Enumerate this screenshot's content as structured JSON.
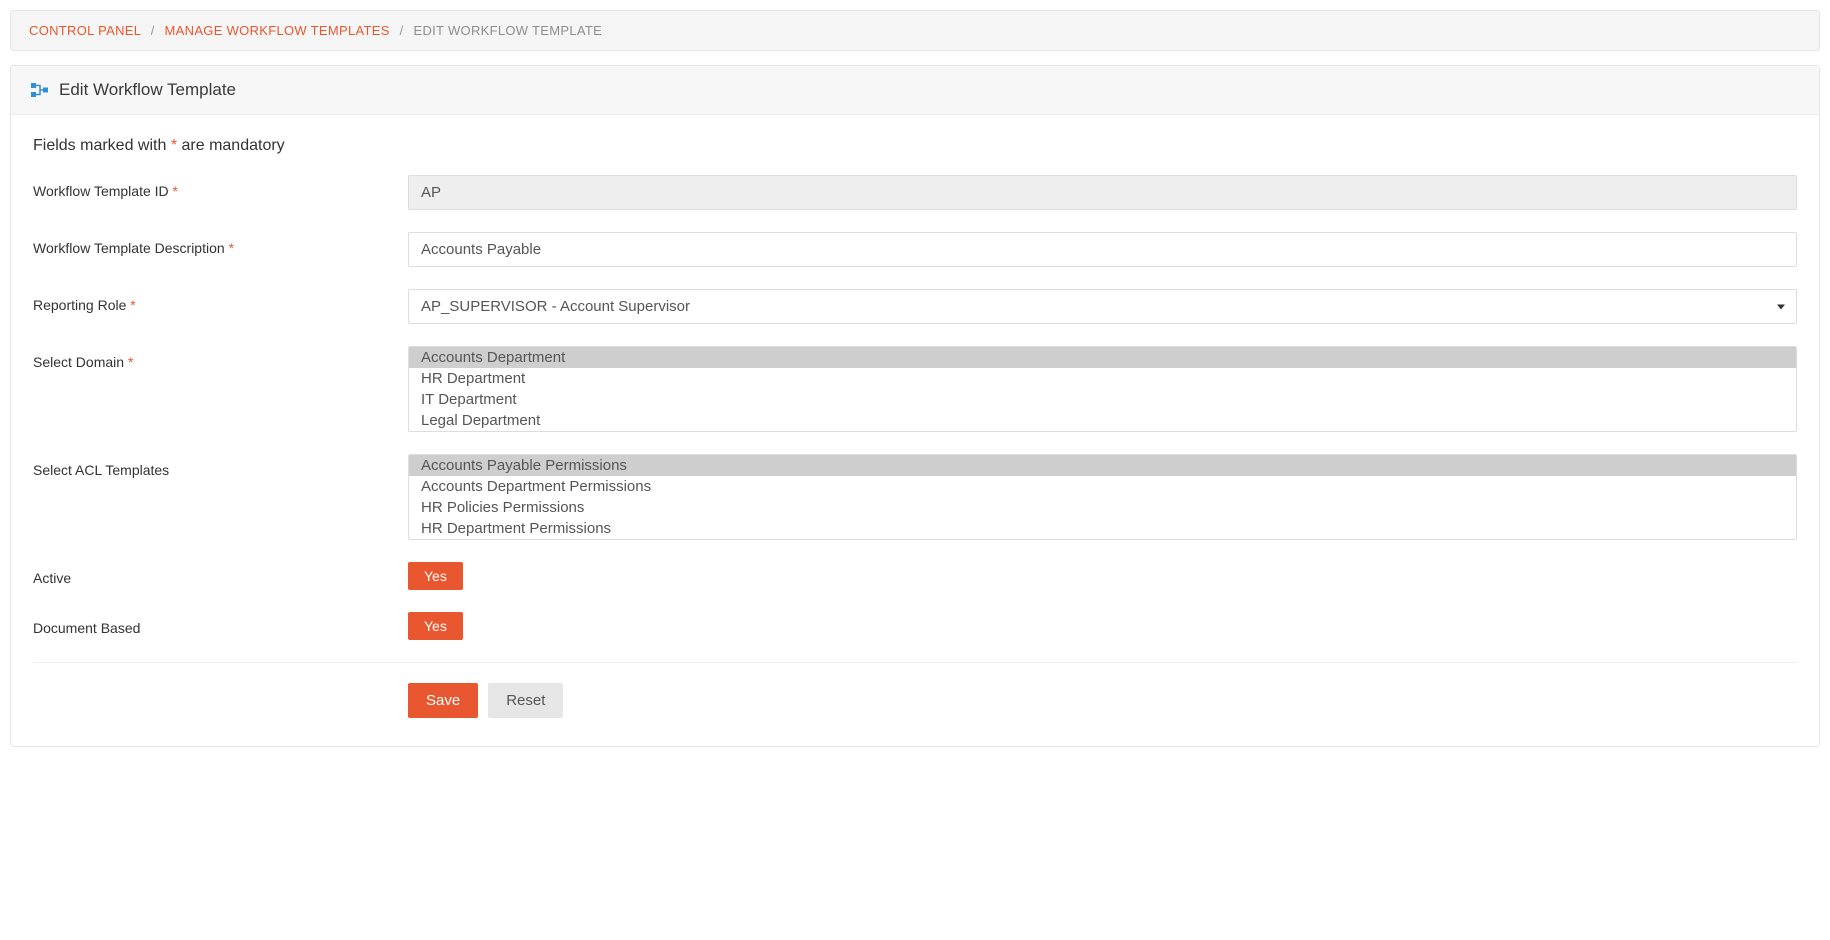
{
  "breadcrumb": {
    "items": [
      {
        "label": "CONTROL PANEL",
        "link": true
      },
      {
        "label": "MANAGE WORKFLOW TEMPLATES",
        "link": true
      },
      {
        "label": "EDIT WORKFLOW TEMPLATE",
        "link": false
      }
    ],
    "separator": "/"
  },
  "panel": {
    "title": "Edit Workflow Template"
  },
  "mandatory_note": {
    "prefix": "Fields marked with ",
    "star": "*",
    "suffix": " are mandatory"
  },
  "form": {
    "template_id": {
      "label": "Workflow Template ID",
      "required": true,
      "value": "AP",
      "disabled": true
    },
    "template_desc": {
      "label": "Workflow Template Description",
      "required": true,
      "value": "Accounts Payable"
    },
    "reporting_role": {
      "label": "Reporting Role",
      "required": true,
      "selected": "AP_SUPERVISOR - Account Supervisor",
      "options": [
        "AP_SUPERVISOR - Account Supervisor"
      ]
    },
    "select_domain": {
      "label": "Select Domain",
      "required": true,
      "options": [
        "Accounts Department",
        "HR Department",
        "IT Department",
        "Legal Department"
      ],
      "selected": [
        "Accounts Department"
      ]
    },
    "select_acl": {
      "label": "Select ACL Templates",
      "required": false,
      "options": [
        "Accounts Payable Permissions",
        "Accounts Department Permissions",
        "HR Policies Permissions",
        "HR Department Permissions"
      ],
      "selected": [
        "Accounts Payable Permissions"
      ]
    },
    "active": {
      "label": "Active",
      "value": "Yes"
    },
    "document_based": {
      "label": "Document Based",
      "value": "Yes"
    }
  },
  "actions": {
    "save": "Save",
    "reset": "Reset"
  },
  "colors": {
    "accent": "#e8572f"
  }
}
